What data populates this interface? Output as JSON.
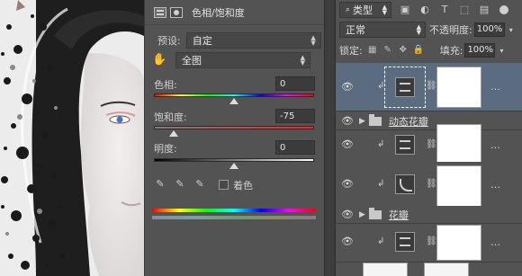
{
  "properties": {
    "title": "色相/饱和度",
    "preset_label": "预设:",
    "preset_value": "自定",
    "range_value": "全图",
    "hue_label": "色相:",
    "hue_value": "0",
    "saturation_label": "饱和度:",
    "saturation_value": "-75",
    "lightness_label": "明度:",
    "lightness_value": "0",
    "colorize_label": "着色",
    "icons": [
      "hue-saturation-icon",
      "mask-icon",
      "targeted-adjustment-hand-icon",
      "eyedropper-icon",
      "eyedropper-plus-icon",
      "eyedropper-minus-icon"
    ]
  },
  "layers": {
    "kind_filter": "类型",
    "blend_mode": "正常",
    "opacity_label": "不透明度:",
    "opacity_value": "100%",
    "lock_label": "锁定:",
    "fill_label": "填充:",
    "fill_value": "100%",
    "filter_icons": [
      "image-filter-icon",
      "adjustment-filter-icon",
      "type-filter-icon",
      "shape-filter-icon",
      "smart-object-filter-icon"
    ],
    "group_1_name": "动态花瓣",
    "group_2_name": "花瓣"
  }
}
